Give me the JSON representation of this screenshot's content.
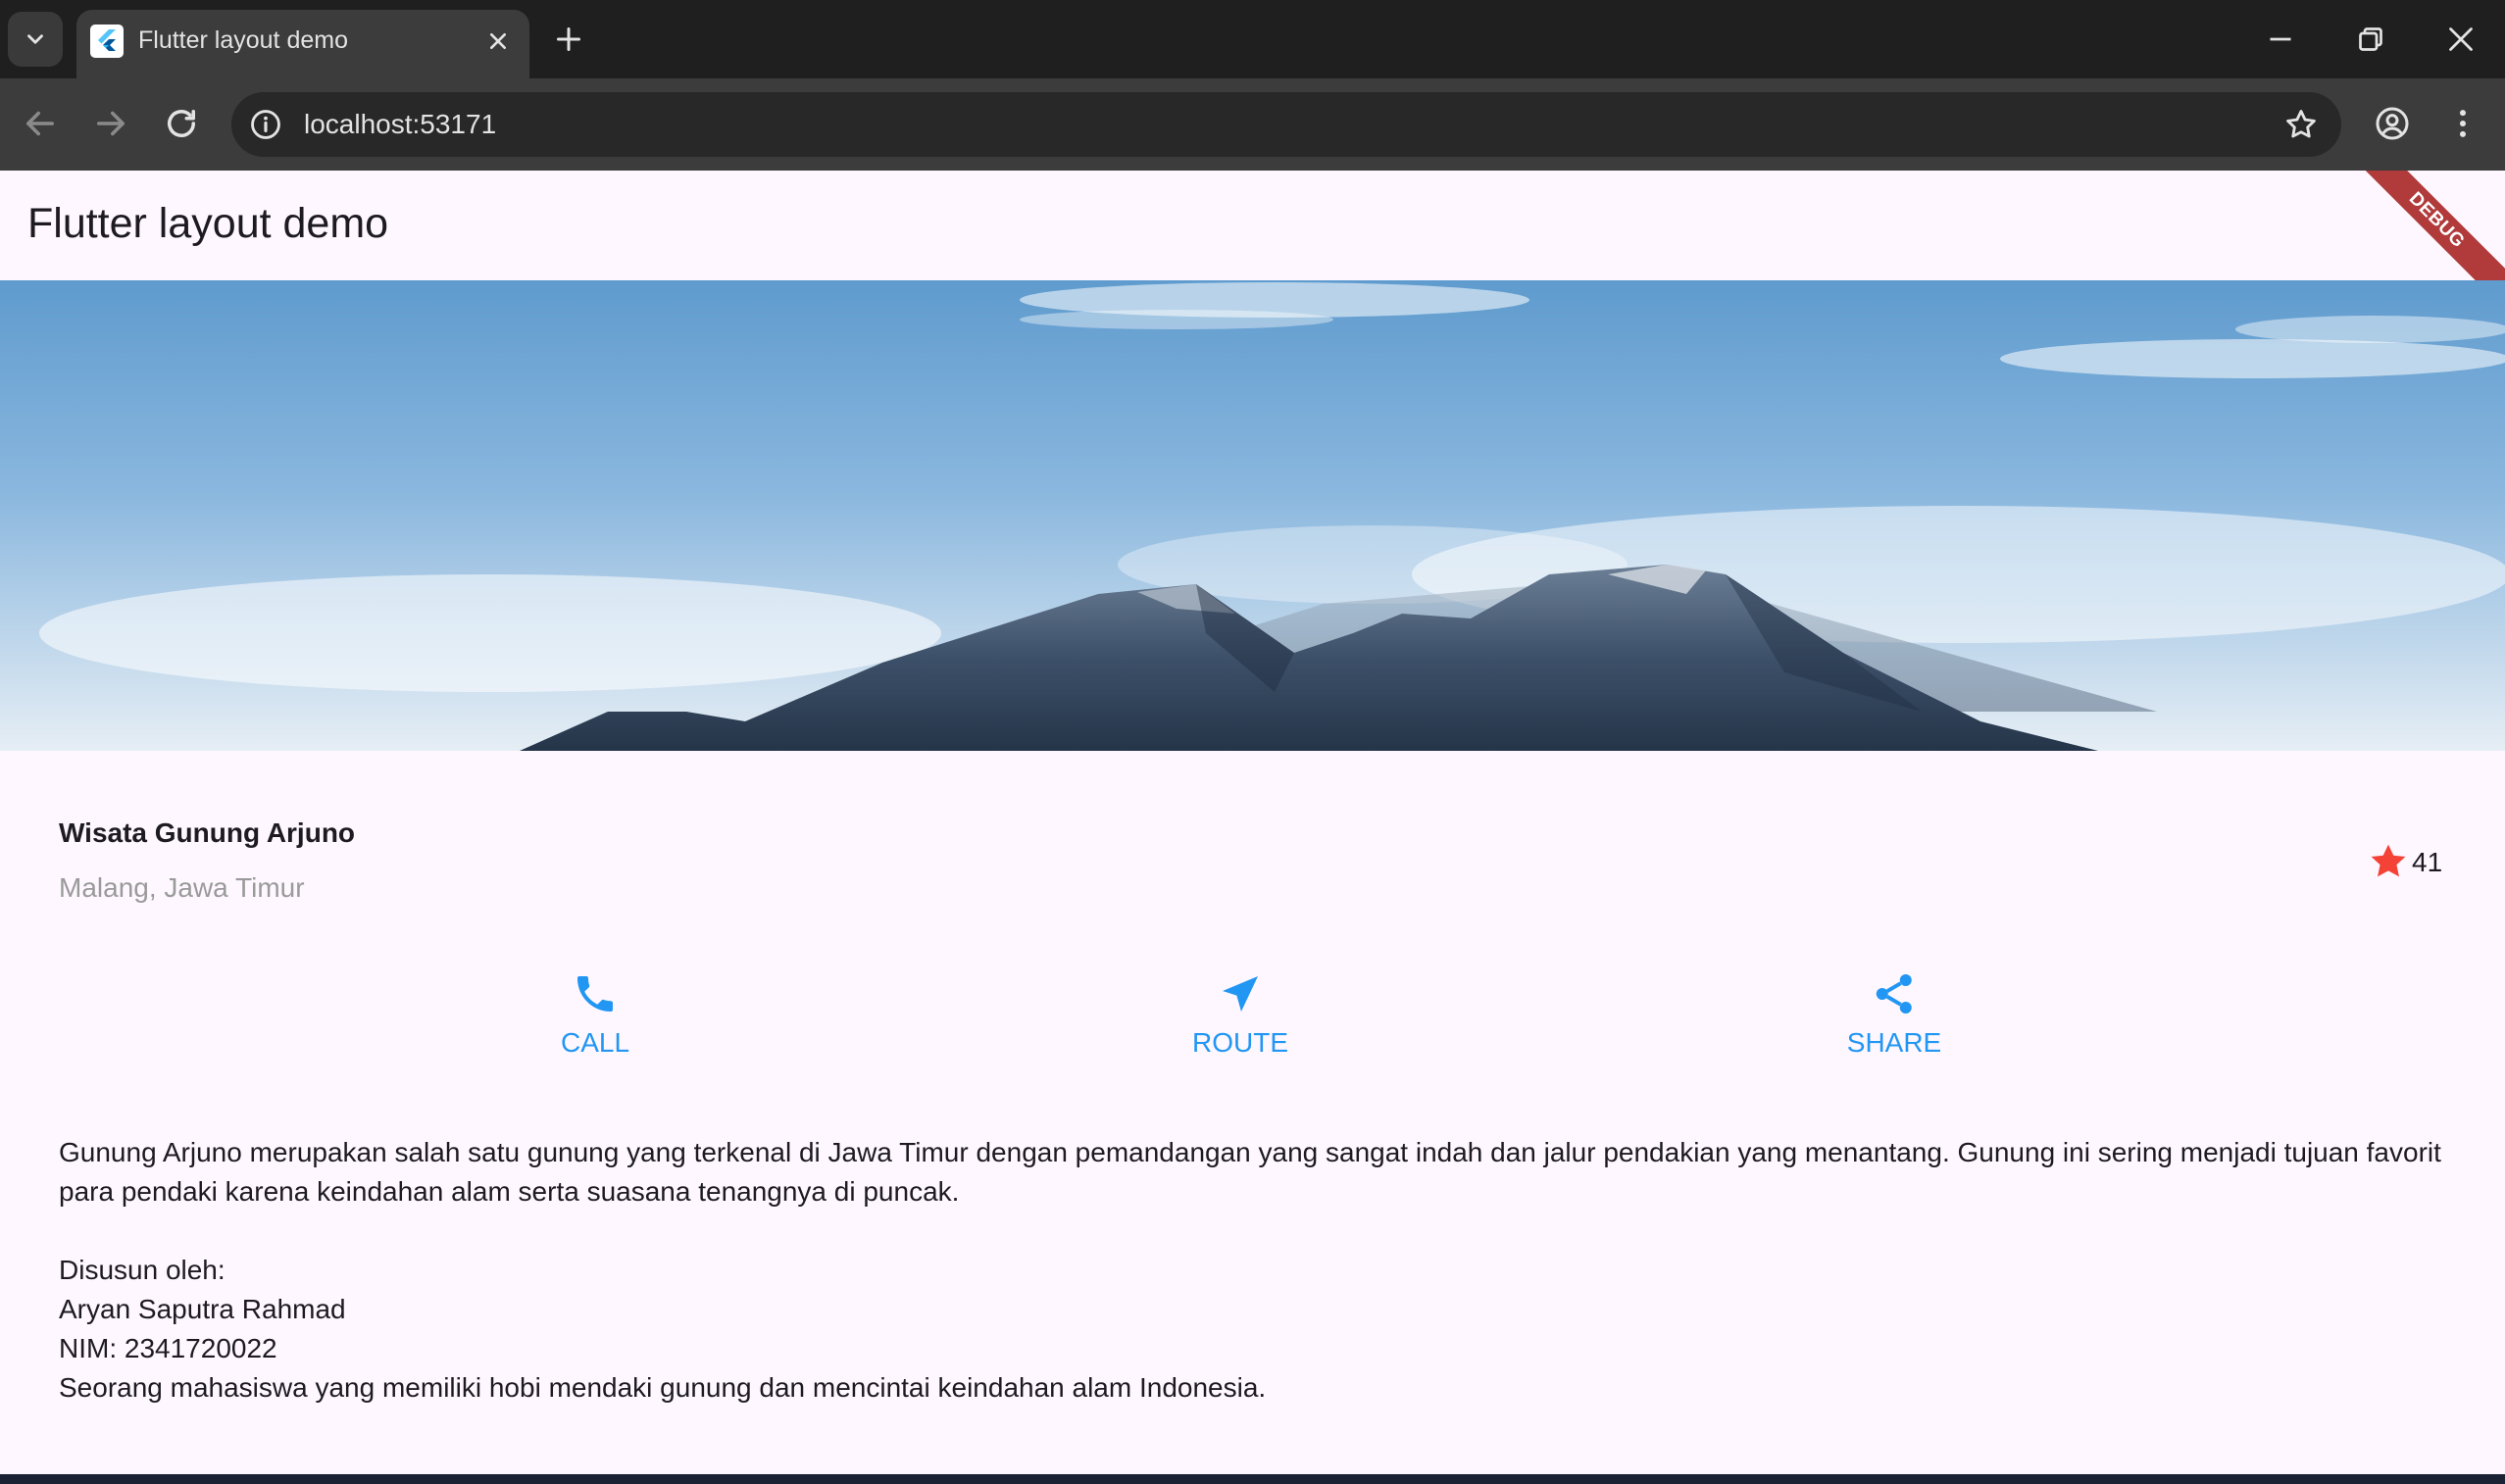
{
  "browser": {
    "tab_title": "Flutter layout demo",
    "url": "localhost:53171"
  },
  "app": {
    "title": "Flutter layout demo",
    "debug_banner": "DEBUG"
  },
  "place": {
    "name": "Wisata Gunung Arjuno",
    "location": "Malang, Jawa Timur",
    "rating_count": "41"
  },
  "actions": [
    {
      "label": "CALL",
      "icon": "phone-icon"
    },
    {
      "label": "ROUTE",
      "icon": "navigation-icon"
    },
    {
      "label": "SHARE",
      "icon": "share-icon"
    }
  ],
  "description": {
    "paragraph": "Gunung Arjuno merupakan salah satu gunung yang terkenal di Jawa Timur dengan pemandangan yang sangat indah dan jalur pendakian yang menantang. Gunung ini sering menjadi tujuan favorit para pendaki karena keindahan alam serta suasana tenangnya di puncak.",
    "author_heading": "Disusun oleh:",
    "author_name": "Aryan Saputra Rahmad",
    "author_nim": "NIM: 2341720022",
    "author_bio": "Seorang mahasiswa yang memiliki hobi mendaki gunung dan mencintai keindahan alam Indonesia."
  },
  "colors": {
    "accent": "#2196f3",
    "star": "#f44336",
    "background": "#fef7ff"
  }
}
